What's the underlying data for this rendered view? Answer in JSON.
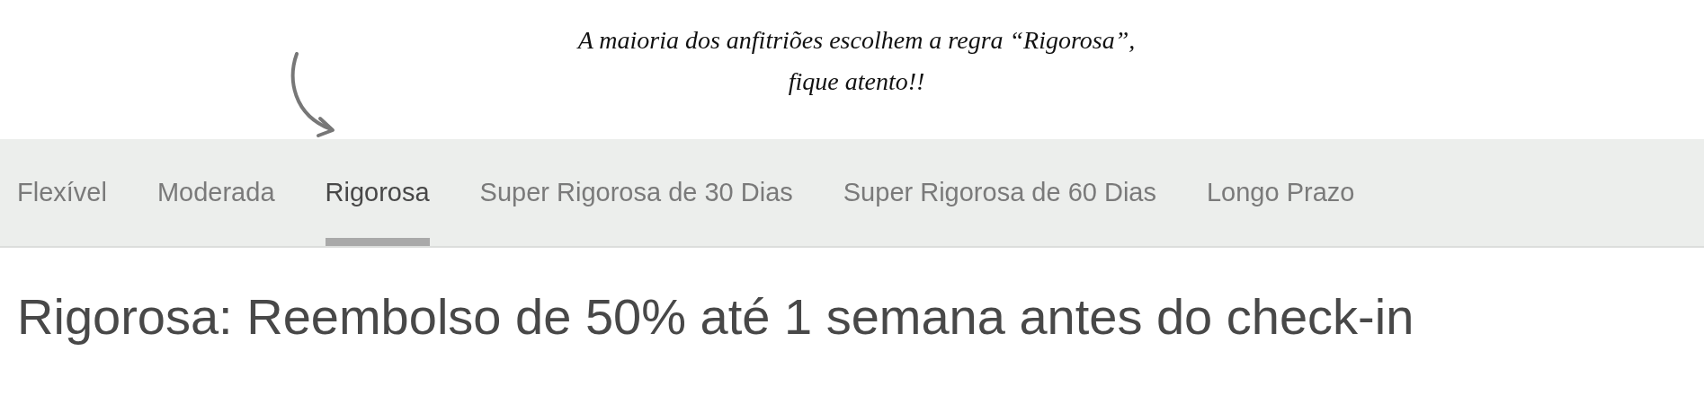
{
  "annotation": {
    "text": "A maioria dos anfitriões escolhem a regra “Rigorosa”, fique atento!!"
  },
  "tabs": [
    {
      "label": "Flexível",
      "selected": false
    },
    {
      "label": "Moderada",
      "selected": false
    },
    {
      "label": "Rigorosa",
      "selected": true
    },
    {
      "label": "Super Rigorosa de 30 Dias",
      "selected": false
    },
    {
      "label": "Super Rigorosa de 60 Dias",
      "selected": false
    },
    {
      "label": "Longo Prazo",
      "selected": false
    }
  ],
  "heading": "Rigorosa: Reembolso de 50% até 1 semana antes do check-in"
}
